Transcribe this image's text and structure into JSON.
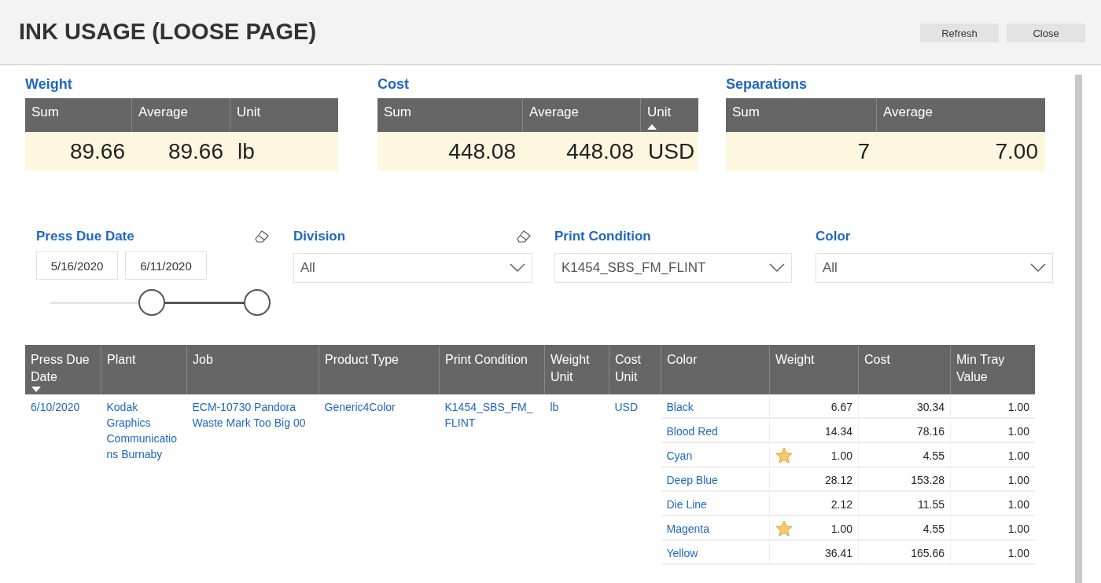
{
  "window": {
    "title": "INK USAGE (LOOSE PAGE)",
    "buttons": [
      "Refresh",
      "Close"
    ]
  },
  "summaries": [
    {
      "title": "Weight",
      "columns": [
        {
          "label": "Sum",
          "sorted_up": false
        },
        {
          "label": "Average",
          "sorted_up": false
        },
        {
          "label": "Unit",
          "sorted_up": false
        }
      ],
      "values": [
        "89.66",
        "89.66",
        "lb"
      ]
    },
    {
      "title": "Cost",
      "columns": [
        {
          "label": "Sum",
          "sorted_up": false
        },
        {
          "label": "Average",
          "sorted_up": false
        },
        {
          "label": "Unit",
          "sorted_up": true
        }
      ],
      "values": [
        "448.08",
        "448.08",
        "USD"
      ]
    },
    {
      "title": "Separations",
      "columns": [
        {
          "label": "Sum",
          "sorted_up": false
        },
        {
          "label": "Average",
          "sorted_up": false
        }
      ],
      "values": [
        "7",
        "7.00"
      ]
    }
  ],
  "filters": [
    {
      "kind": "date_range",
      "label": "Press Due Date",
      "start": "5/16/2020",
      "end": "6/11/2020",
      "thumbs": [
        {
          "level": 0.46
        },
        {
          "level": 0.94
        }
      ]
    },
    {
      "kind": "dropdown",
      "label": "Division",
      "value": "All",
      "clearable": true
    },
    {
      "kind": "dropdown",
      "label": "Print Condition",
      "value": "K1454_SBS_FM_FLINT",
      "clearable": false
    },
    {
      "kind": "dropdown",
      "label": "Color",
      "value": "All",
      "clearable": false
    }
  ],
  "table": {
    "columns": [
      {
        "label": "Press Due Date",
        "sorted_down": true
      },
      {
        "label": "Plant",
        "sorted_down": false
      },
      {
        "label": "Job",
        "sorted_down": false
      },
      {
        "label": "Product Type",
        "sorted_down": false
      },
      {
        "label": "Print Condition",
        "sorted_down": false
      },
      {
        "label": "Weight Unit",
        "sorted_down": false
      },
      {
        "label": "Cost Unit",
        "sorted_down": false
      },
      {
        "label": "Color",
        "sorted_down": false
      },
      {
        "label": "Weight",
        "sorted_down": false
      },
      {
        "label": "Cost",
        "sorted_down": false
      },
      {
        "label": "Min Tray Value",
        "sorted_down": false
      }
    ],
    "rows": [
      {
        "press_due_date": "6/10/2020",
        "plant": "Kodak Graphics Communications Burnaby",
        "job": "ECM-10730 Pandora Waste Mark Too Big 00",
        "product_type": "Generic4Color",
        "print_condition": "K1454_SBS_FM_FLINT",
        "weight_unit": "lb",
        "cost_unit": "USD",
        "colors": [
          {
            "ink": "Black",
            "starred": false,
            "weight": "6.67",
            "cost": "30.34",
            "min_tray_value": "1.00"
          },
          {
            "ink": "Blood Red",
            "starred": false,
            "weight": "14.34",
            "cost": "78.16",
            "min_tray_value": "1.00"
          },
          {
            "ink": "Cyan",
            "starred": true,
            "weight": "1.00",
            "cost": "4.55",
            "min_tray_value": "1.00"
          },
          {
            "ink": "Deep Blue",
            "starred": false,
            "weight": "28.12",
            "cost": "153.28",
            "min_tray_value": "1.00"
          },
          {
            "ink": "Die Line",
            "starred": false,
            "weight": "2.12",
            "cost": "11.55",
            "min_tray_value": "1.00"
          },
          {
            "ink": "Magenta",
            "starred": true,
            "weight": "1.00",
            "cost": "4.55",
            "min_tray_value": "1.00"
          },
          {
            "ink": "Yellow",
            "starred": false,
            "weight": "36.41",
            "cost": "165.66",
            "min_tray_value": "1.00"
          }
        ]
      }
    ]
  }
}
